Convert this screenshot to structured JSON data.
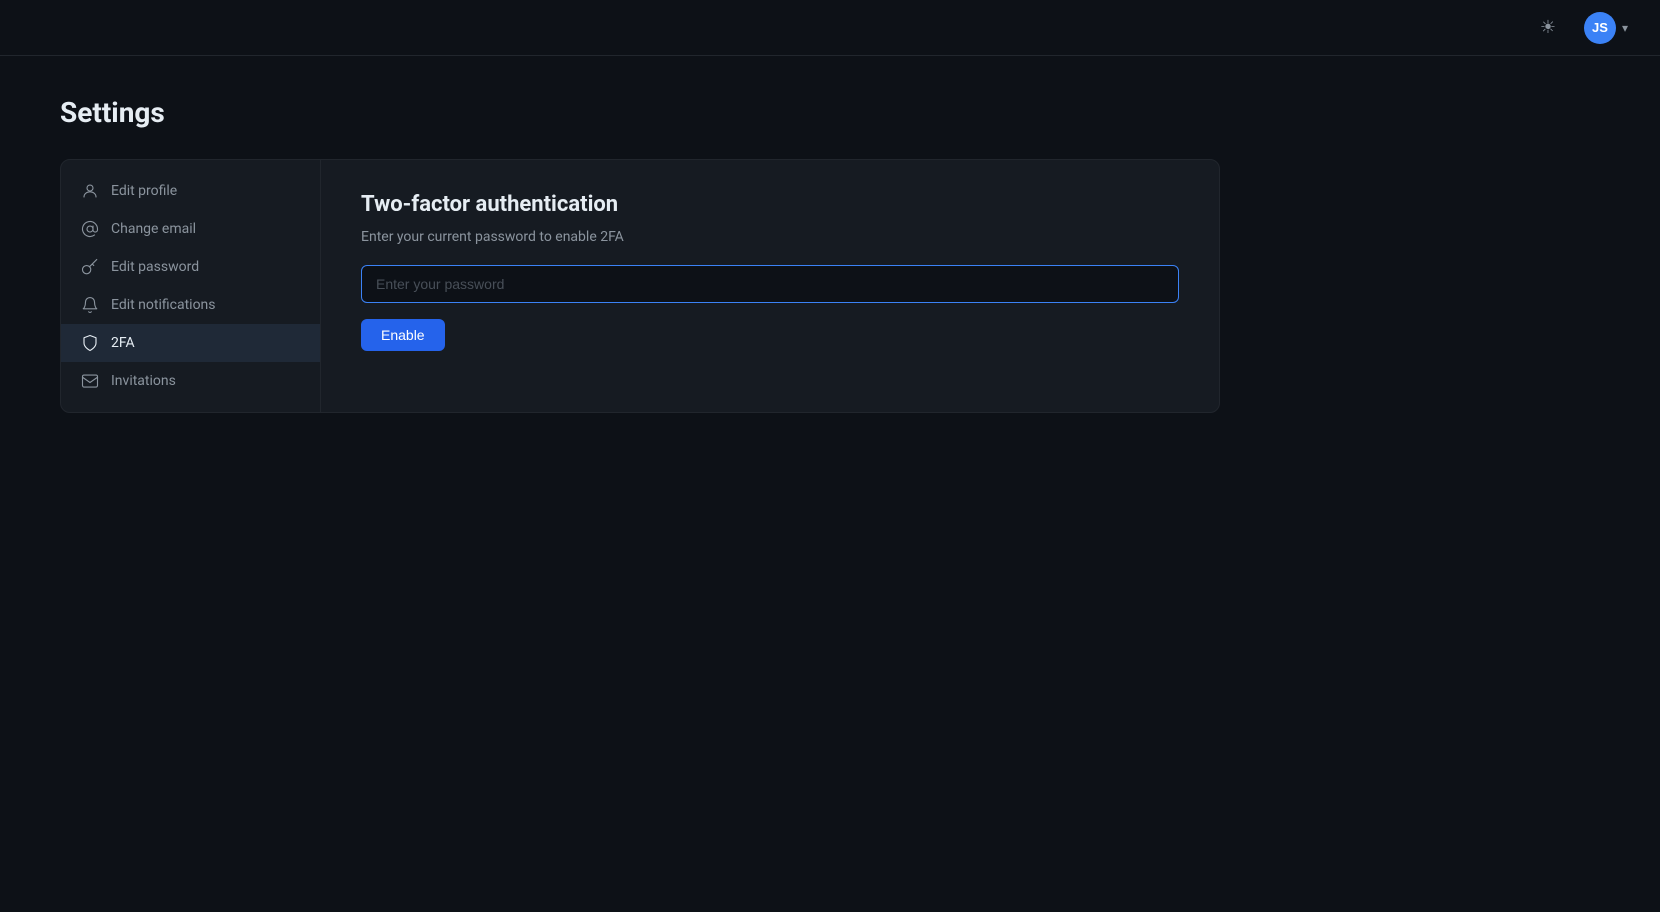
{
  "topbar": {
    "avatar_initials": "JS",
    "avatar_bg": "#3b82f6"
  },
  "page": {
    "title": "Settings"
  },
  "sidebar": {
    "items": [
      {
        "id": "edit-profile",
        "label": "Edit profile",
        "icon": "user"
      },
      {
        "id": "change-email",
        "label": "Change email",
        "icon": "at-sign"
      },
      {
        "id": "edit-password",
        "label": "Edit password",
        "icon": "key"
      },
      {
        "id": "edit-notifications",
        "label": "Edit notifications",
        "icon": "bell"
      },
      {
        "id": "2fa",
        "label": "2FA",
        "icon": "shield",
        "active": true
      },
      {
        "id": "invitations",
        "label": "Invitations",
        "icon": "mail"
      }
    ]
  },
  "main": {
    "section_title": "Two-factor authentication",
    "section_subtitle": "Enter your current password to enable 2FA",
    "password_placeholder": "Enter your password",
    "enable_button_label": "Enable"
  }
}
